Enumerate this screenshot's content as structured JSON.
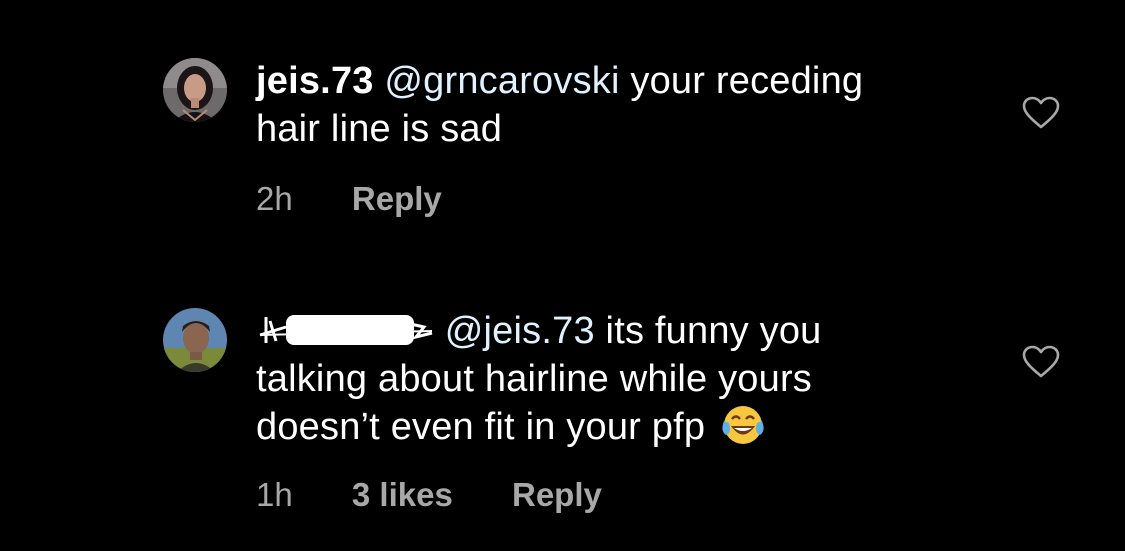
{
  "comments": [
    {
      "username": "jeis.73",
      "mention": "@grncarovski",
      "text_line1": " your receding",
      "text_line2": "hair line is sad",
      "time": "2h",
      "reply_label": "Reply",
      "avatar_icon": "profile-photo-woman",
      "like_icon": "heart-outline-icon"
    },
    {
      "username_redacted": true,
      "mention": "@jeis.73",
      "text_line1": " its funny you",
      "text_line2": "talking about hairline while yours",
      "text_line3": "doesn’t even fit in your pfp",
      "emoji_icon": "face-with-tears-of-joy",
      "time": "1h",
      "likes": "3 likes",
      "reply_label": "Reply",
      "avatar_icon": "profile-photo-man",
      "like_icon": "heart-outline-icon"
    }
  ],
  "colors": {
    "background": "#000000",
    "text": "#ffffff",
    "meta": "#a8a8a8",
    "mention": "#e0f1ff"
  }
}
